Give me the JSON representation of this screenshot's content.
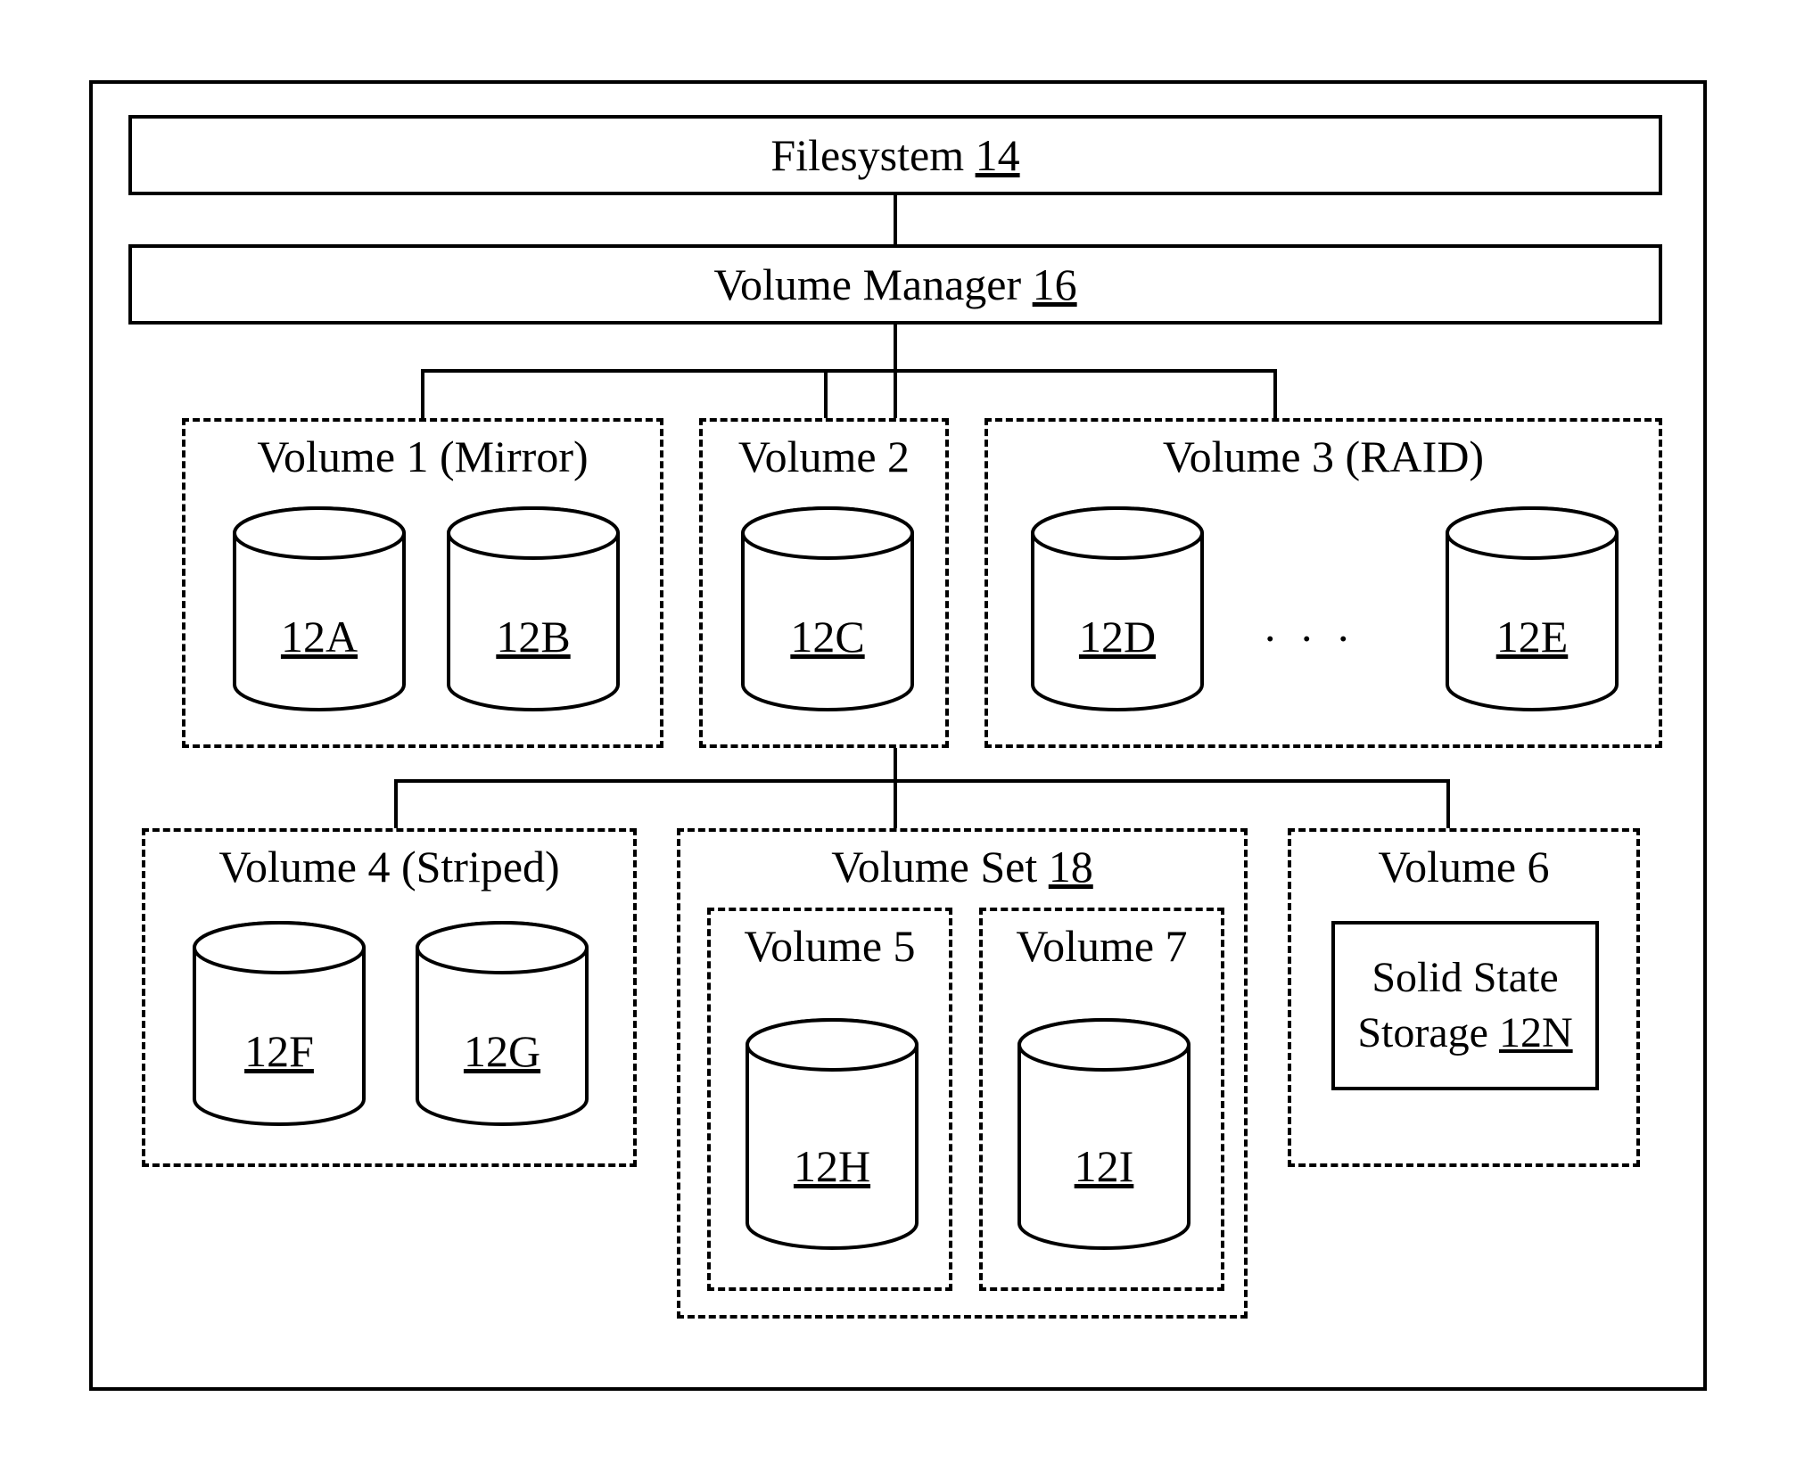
{
  "filesystem": {
    "label": "Filesystem",
    "ref": "14"
  },
  "volume_manager": {
    "label": "Volume Manager",
    "ref": "16"
  },
  "volumes": {
    "v1": {
      "title": "Volume 1 (Mirror)",
      "disks": [
        "12A",
        "12B"
      ]
    },
    "v2": {
      "title": "Volume 2",
      "disks": [
        "12C"
      ]
    },
    "v3": {
      "title": "Volume 3 (RAID)",
      "disks": [
        "12D",
        "12E"
      ],
      "ellipsis": ". . ."
    },
    "v4": {
      "title": "Volume 4 (Striped)",
      "disks": [
        "12F",
        "12G"
      ]
    },
    "vset": {
      "title_label": "Volume Set",
      "title_ref": "18",
      "inner": {
        "v5": {
          "title": "Volume 5",
          "disks": [
            "12H"
          ]
        },
        "v7": {
          "title": "Volume 7",
          "disks": [
            "12I"
          ]
        }
      }
    },
    "v6": {
      "title": "Volume 6",
      "storage": {
        "line1": "Solid State",
        "line2_label": "Storage",
        "line2_ref": "12N"
      }
    }
  }
}
